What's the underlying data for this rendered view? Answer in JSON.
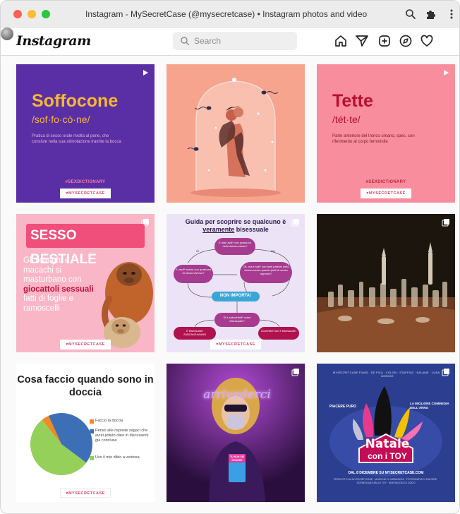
{
  "window": {
    "title": "Instagram - MySecretCase (@mysecretcase) • Instagram photos and videos"
  },
  "header": {
    "logo": "Instagram",
    "search_placeholder": "Search"
  },
  "posts": [
    {
      "word": "Soffocone",
      "phonetic": "/sof·fo·cò·ne/",
      "definition": "Pratica di sesso orale rivolta al pene, che consiste nella sua stimolazione tramite la bocca",
      "tag": "#SEXDICTIONARY",
      "brand": "MYSECRETCASE",
      "colors": {
        "bg": "#5a2fa6",
        "accent": "#f7b733"
      },
      "corner_icon": "video-reel-icon"
    },
    {
      "brand": "",
      "colors": {
        "bg": "#f6a48e"
      },
      "corner_icon": ""
    },
    {
      "word": "Tette",
      "phonetic": "/tét·te/",
      "definition": "Parte anteriore del tronco umano, spec. con riferimento al corpo femminile",
      "tag": "#SEXDICTIONARY",
      "brand": "MYSECRETCASE",
      "colors": {
        "bg": "#f88e9d",
        "accent": "#b8102f"
      },
      "corner_icon": "video-reel-icon"
    },
    {
      "headline": "SESSO BESTIALE",
      "body_part1": "Gli oranghi e i macachi si masturbano con ",
      "body_bold": "giocattoli sessuali",
      "body_part2": " fatti di foglie e ramoscelli",
      "brand": "MYSECRETCASE",
      "colors": {
        "bg": "#f8b6c7",
        "accent": "#ef4f7a"
      },
      "corner_icon": "carousel-icon"
    },
    {
      "heading_part1": "Guida per scoprire se qualcuno è ",
      "heading_underlined": "veramente",
      "heading_part2": " bisessuale",
      "nodes": {
        "q1": "E mai uscit* con qualcuno dello stesso sesso?",
        "q2": "E uscit* anche con qualcuno di sesso diverso?",
        "q3": "Ok, ma è stat* con tanti partner dello stesso sesso quanti quelli di sesso opposto?",
        "middle": "NON IMPORTA!",
        "q4": "Si è autodefinit* come bisessuale?",
        "a1": "È bisessuale! ZANZANZAAANN",
        "a2": "Dovrebbe non è bisessuale!"
      },
      "labels": {
        "si": "SÌ",
        "no": "NO"
      },
      "brand": "MYSECRETCASE",
      "colors": {
        "bg": "#ece4f6",
        "bubble": "#a63b8f",
        "middle": "#3aa6d6",
        "answer": "#b0124d"
      },
      "corner_icon": "carousel-icon"
    },
    {
      "colors": {
        "bg": "#1d1811"
      },
      "corner_icon": "carousel-icon"
    },
    {
      "heading": "Cosa faccio quando sono in doccia",
      "chart_data": {
        "type": "pie",
        "title": "Cosa faccio quando sono in doccia",
        "slices": [
          {
            "label": "Faccio la doccia",
            "value": 4,
            "color": "#f08a24"
          },
          {
            "label": "Penso alle risposte sagaci che avrei potuto dare in discussioni già concluse",
            "value": 42,
            "color": "#3d6fb6"
          },
          {
            "label": "Uso il mio dildo a ventosa",
            "value": 54,
            "color": "#94d05a"
          }
        ]
      },
      "brand": "MYSECRETCASE",
      "corner_icon": ""
    },
    {
      "neon_sign": "arrivederci",
      "book_title": "TU NON SEI GRANDE",
      "colors": {
        "bg": "#2a0f3e",
        "neon": "#d3a9ff"
      },
      "corner_icon": "carousel-icon"
    },
    {
      "credits": "MYSECRETCASE FILMS · DE FICA · COLON · STAFFILE · SALAME · LUNA · MOSCIO",
      "piacere": "PIACERE PURO",
      "migliore": "LA MIGLIORE COMMEDIA DELL'ANNO",
      "title1": "Natale",
      "title2": "con i TOY",
      "date": "DAL 8 DICEMBRE SU MYSECRETCASE.COM",
      "fine": "PRODOTTO DA MYSECRETCASE · MUSICHE DI VIBRAZIONI · FOTOGRAFIA DI PIACERE · SCENEGGIATURA DI TOY · MONTAGGIO DI GODO",
      "colors": {
        "bg": "#2c3e8f",
        "glow": "#d0105a"
      },
      "corner_icon": "carousel-icon"
    }
  ]
}
